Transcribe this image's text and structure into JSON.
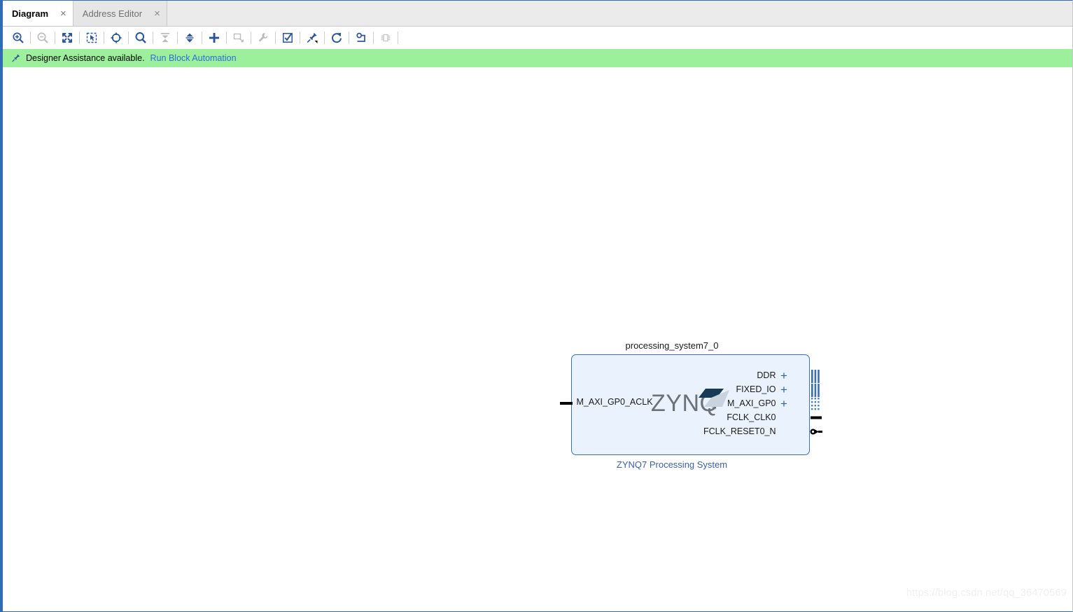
{
  "window": {
    "tabs": [
      {
        "label": "Diagram",
        "active": true,
        "close_glyph": "×"
      },
      {
        "label": "Address Editor",
        "active": false,
        "close_glyph": "×"
      }
    ]
  },
  "toolbar": {
    "buttons": [
      {
        "name": "zoom-in-icon",
        "title": "Zoom In",
        "enabled": true
      },
      {
        "name": "zoom-out-icon",
        "title": "Zoom Out",
        "enabled": false
      },
      {
        "name": "zoom-fit-icon",
        "title": "Zoom Fit",
        "enabled": true
      },
      {
        "name": "zoom-area-icon",
        "title": "Zoom Area",
        "enabled": true
      },
      {
        "name": "fit-selection-icon",
        "title": "Fit Selection",
        "enabled": true
      },
      {
        "name": "search-icon",
        "title": "Search",
        "enabled": true
      },
      {
        "name": "collapse-all-icon",
        "title": "Collapse All",
        "enabled": false
      },
      {
        "name": "expand-all-icon",
        "title": "Expand All",
        "enabled": true
      },
      {
        "name": "add-ip-icon",
        "title": "Add IP",
        "enabled": true
      },
      {
        "name": "add-module-icon",
        "title": "Add Module",
        "enabled": false
      },
      {
        "name": "customize-block-icon",
        "title": "Customize Block",
        "enabled": false
      },
      {
        "name": "validate-design-icon",
        "title": "Validate Design",
        "enabled": true
      },
      {
        "name": "designer-assistance-icon",
        "title": "Run Connection Automation",
        "enabled": true
      },
      {
        "name": "regenerate-layout-icon",
        "title": "Regenerate Layout",
        "enabled": true
      },
      {
        "name": "optimize-routing-icon",
        "title": "Optimize Routing",
        "enabled": true
      },
      {
        "name": "interface-connection-icon",
        "title": "Interface Connection",
        "enabled": false
      }
    ],
    "separators_after": [
      0,
      1,
      2,
      3,
      4,
      5,
      6,
      7,
      8,
      9,
      10,
      11,
      12,
      13,
      14,
      15
    ]
  },
  "banner": {
    "icon": "designer-assistance-pin-icon",
    "text": "Designer Assistance available.",
    "link_label": "Run Block Automation",
    "background_color": "#9cf09c",
    "link_color": "#2f6cdb"
  },
  "diagram": {
    "block": {
      "instance_name": "processing_system7_0",
      "caption": "ZYNQ7 Processing System",
      "logo_text": "ZYNQ",
      "logo_tm": "™",
      "fill_color": "#eaf2fd",
      "border_color": "#3c6fae",
      "caption_color": "#3a5fa8",
      "input_ports": [
        {
          "label": "M_AXI_GP0_ACLK",
          "type": "pin"
        }
      ],
      "output_ports": [
        {
          "label": "DDR",
          "type": "bus",
          "expandable": true,
          "connector": "bus-solid"
        },
        {
          "label": "FIXED_IO",
          "type": "bus",
          "expandable": true,
          "connector": "bus-solid"
        },
        {
          "label": "M_AXI_GP0",
          "type": "bus",
          "expandable": true,
          "connector": "bus-dotted"
        },
        {
          "label": "FCLK_CLK0",
          "type": "pin",
          "expandable": false,
          "connector": "pin-stub"
        },
        {
          "label": "FCLK_RESET0_N",
          "type": "pin",
          "expandable": false,
          "connector": "pin-arrow"
        }
      ],
      "expand_glyph": "+"
    }
  },
  "watermark": {
    "text": "https://blog.csdn.net/qq_36470569"
  }
}
